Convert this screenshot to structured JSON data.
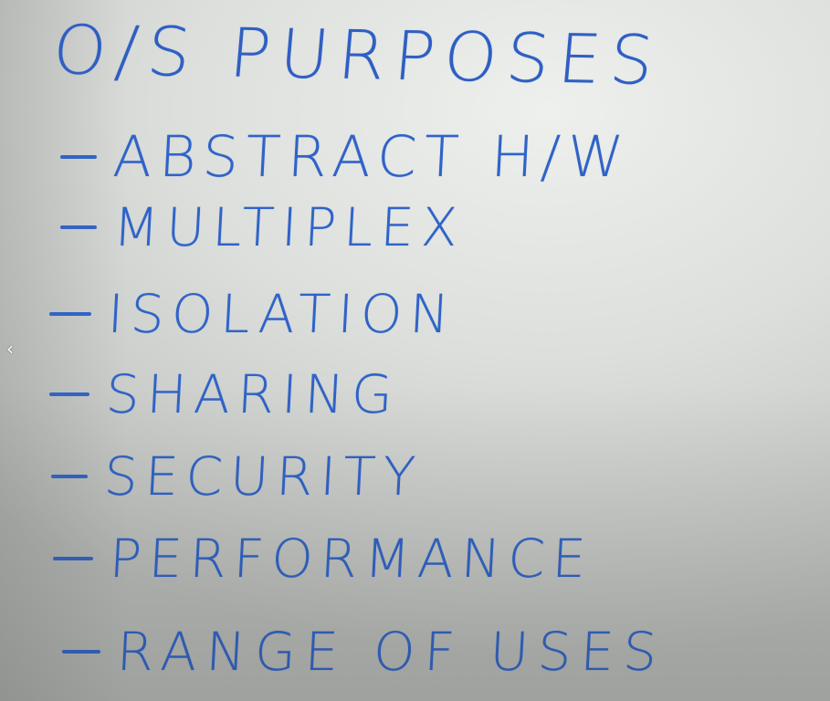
{
  "board": {
    "heading": "O/S PURPOSES",
    "items": [
      {
        "label": "ABSTRACT H/W"
      },
      {
        "label": "MULTIPLEX"
      },
      {
        "label": "ISOLATION"
      },
      {
        "label": "SHARING"
      },
      {
        "label": "SECURITY"
      },
      {
        "label": "PERFORMANCE"
      },
      {
        "label": "RANGE OF USES"
      }
    ],
    "ink_color": "#2f63c8"
  },
  "navigation": {
    "prev_icon": "chevron-left-icon",
    "prev_glyph": "‹"
  }
}
